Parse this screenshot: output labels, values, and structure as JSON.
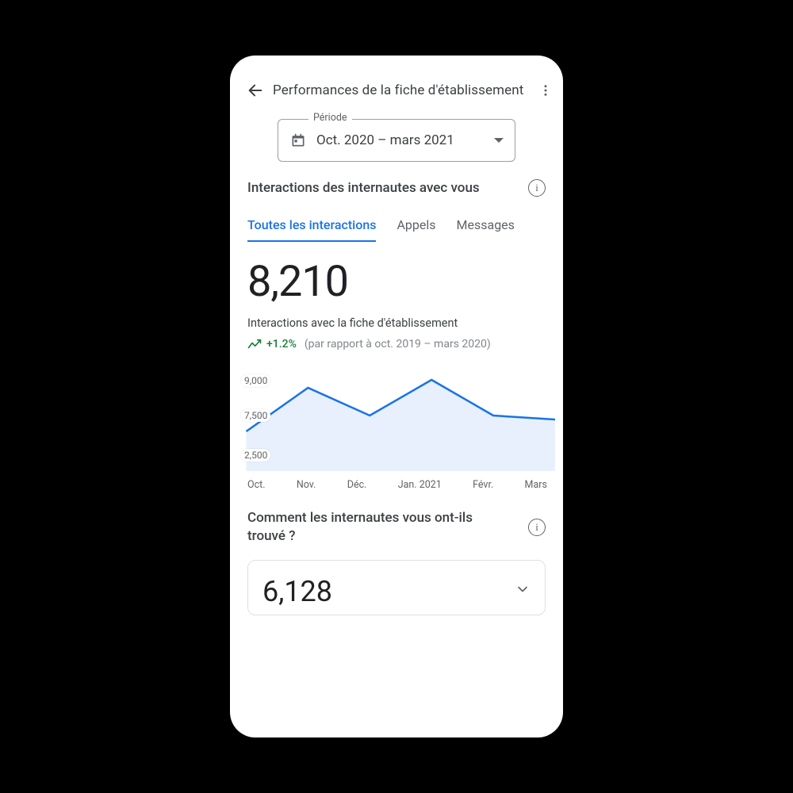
{
  "appbar": {
    "title": "Performances de la fiche d'établissement"
  },
  "period": {
    "label": "Période",
    "value": "Oct. 2020 – mars 2021"
  },
  "section1": {
    "title": "Interactions des internautes avec vous"
  },
  "tabs": {
    "all": "Toutes les interactions",
    "calls": "Appels",
    "messages": "Messages"
  },
  "metric": {
    "value": "8,210",
    "subtitle": "Interactions avec la fiche d'établissement",
    "trend_value": "+1.2%",
    "trend_compare": "(par rapport à oct. 2019 – mars 2020)"
  },
  "chart_data": {
    "type": "area",
    "categories": [
      "Oct.",
      "Nov.",
      "Déc.",
      "Jan. 2021",
      "Févr.",
      "Mars"
    ],
    "values": [
      7000,
      8600,
      7600,
      8900,
      7800,
      7700
    ],
    "yticks": {
      "t0": "9,000",
      "t1": "7,500",
      "t2": "2,500"
    },
    "ylim": [
      0,
      9000
    ],
    "x0": "Oct.",
    "x1": "Nov.",
    "x2": "Déc.",
    "x3": "Jan. 2021",
    "x4": "Févr.",
    "x5": "Mars",
    "stroke": "#1a73e8",
    "fill": "#e8f0fe"
  },
  "section2": {
    "title": "Comment les internautes vous ont-ils trouvé ?"
  },
  "card": {
    "value": "6,128"
  }
}
